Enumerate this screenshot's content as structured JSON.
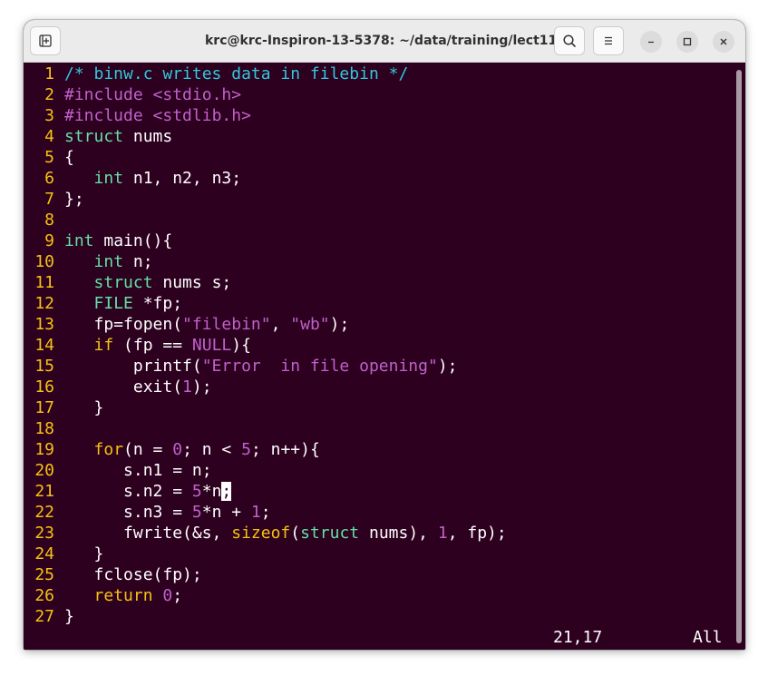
{
  "window": {
    "title": "krc@krc-Inspiron-13-5378: ~/data/training/lect11"
  },
  "icons": {
    "new_tab": "new-tab-icon",
    "search": "search-icon",
    "menu": "hamburger-menu-icon",
    "minimize": "minimize-icon",
    "maximize": "maximize-icon",
    "close": "close-icon"
  },
  "colors": {
    "terminal_bg": "#2c001e",
    "line_number": "#f5c211",
    "comment": "#33c7de",
    "preproc": "#c061cb",
    "type": "#66dea6",
    "statement": "#f5c211",
    "constant": "#c061cb"
  },
  "editor": {
    "lines": [
      {
        "n": "1",
        "tokens": [
          [
            "c",
            "/* binw.c writes data in filebin */"
          ]
        ]
      },
      {
        "n": "2",
        "tokens": [
          [
            "p",
            "#include "
          ],
          [
            "k",
            "<stdio.h>"
          ]
        ]
      },
      {
        "n": "3",
        "tokens": [
          [
            "p",
            "#include "
          ],
          [
            "k",
            "<stdlib.h>"
          ]
        ]
      },
      {
        "n": "4",
        "tokens": [
          [
            "t",
            "struct"
          ],
          [
            "x",
            " nums"
          ]
        ]
      },
      {
        "n": "5",
        "tokens": [
          [
            "x",
            "{"
          ]
        ]
      },
      {
        "n": "6",
        "tokens": [
          [
            "x",
            "   "
          ],
          [
            "t",
            "int"
          ],
          [
            "x",
            " n1, n2, n3;"
          ]
        ]
      },
      {
        "n": "7",
        "tokens": [
          [
            "x",
            "};"
          ]
        ]
      },
      {
        "n": "8",
        "tokens": []
      },
      {
        "n": "9",
        "tokens": [
          [
            "t",
            "int"
          ],
          [
            "x",
            " main(){"
          ]
        ]
      },
      {
        "n": "10",
        "tokens": [
          [
            "x",
            "   "
          ],
          [
            "t",
            "int"
          ],
          [
            "x",
            " n;"
          ]
        ]
      },
      {
        "n": "11",
        "tokens": [
          [
            "x",
            "   "
          ],
          [
            "t",
            "struct"
          ],
          [
            "x",
            " nums s;"
          ]
        ]
      },
      {
        "n": "12",
        "tokens": [
          [
            "x",
            "   "
          ],
          [
            "t",
            "FILE"
          ],
          [
            "x",
            " *fp;"
          ]
        ]
      },
      {
        "n": "13",
        "tokens": [
          [
            "x",
            "   fp=fopen("
          ],
          [
            "k",
            "\"filebin\""
          ],
          [
            "x",
            ", "
          ],
          [
            "k",
            "\"wb\""
          ],
          [
            "x",
            ");"
          ]
        ]
      },
      {
        "n": "14",
        "tokens": [
          [
            "x",
            "   "
          ],
          [
            "s",
            "if"
          ],
          [
            "x",
            " (fp == "
          ],
          [
            "k",
            "NULL"
          ],
          [
            "x",
            "){"
          ]
        ]
      },
      {
        "n": "15",
        "tokens": [
          [
            "x",
            "       printf("
          ],
          [
            "k",
            "\"Error  in file opening\""
          ],
          [
            "x",
            ");"
          ]
        ]
      },
      {
        "n": "16",
        "tokens": [
          [
            "x",
            "       exit("
          ],
          [
            "k",
            "1"
          ],
          [
            "x",
            ");"
          ]
        ]
      },
      {
        "n": "17",
        "tokens": [
          [
            "x",
            "   }"
          ]
        ]
      },
      {
        "n": "18",
        "tokens": []
      },
      {
        "n": "19",
        "tokens": [
          [
            "x",
            "   "
          ],
          [
            "s",
            "for"
          ],
          [
            "x",
            "(n = "
          ],
          [
            "k",
            "0"
          ],
          [
            "x",
            "; n < "
          ],
          [
            "k",
            "5"
          ],
          [
            "x",
            "; n++){"
          ]
        ]
      },
      {
        "n": "20",
        "tokens": [
          [
            "x",
            "      s.n1 = n;"
          ]
        ]
      },
      {
        "n": "21",
        "tokens": [
          [
            "x",
            "      s.n2 = "
          ],
          [
            "k",
            "5"
          ],
          [
            "x",
            "*n"
          ],
          [
            "cur",
            ";"
          ]
        ]
      },
      {
        "n": "22",
        "tokens": [
          [
            "x",
            "      s.n3 = "
          ],
          [
            "k",
            "5"
          ],
          [
            "x",
            "*n + "
          ],
          [
            "k",
            "1"
          ],
          [
            "x",
            ";"
          ]
        ]
      },
      {
        "n": "23",
        "tokens": [
          [
            "x",
            "      fwrite(&s, "
          ],
          [
            "s",
            "sizeof"
          ],
          [
            "x",
            "("
          ],
          [
            "t",
            "struct"
          ],
          [
            "x",
            " nums), "
          ],
          [
            "k",
            "1"
          ],
          [
            "x",
            ", fp);"
          ]
        ]
      },
      {
        "n": "24",
        "tokens": [
          [
            "x",
            "   }"
          ]
        ]
      },
      {
        "n": "25",
        "tokens": [
          [
            "x",
            "   fclose(fp);"
          ]
        ]
      },
      {
        "n": "26",
        "tokens": [
          [
            "x",
            "   "
          ],
          [
            "s",
            "return"
          ],
          [
            "x",
            " "
          ],
          [
            "k",
            "0"
          ],
          [
            "x",
            ";"
          ]
        ]
      },
      {
        "n": "27",
        "tokens": [
          [
            "x",
            "}"
          ]
        ]
      }
    ]
  },
  "status": {
    "position": "21,17",
    "scroll": "All"
  }
}
